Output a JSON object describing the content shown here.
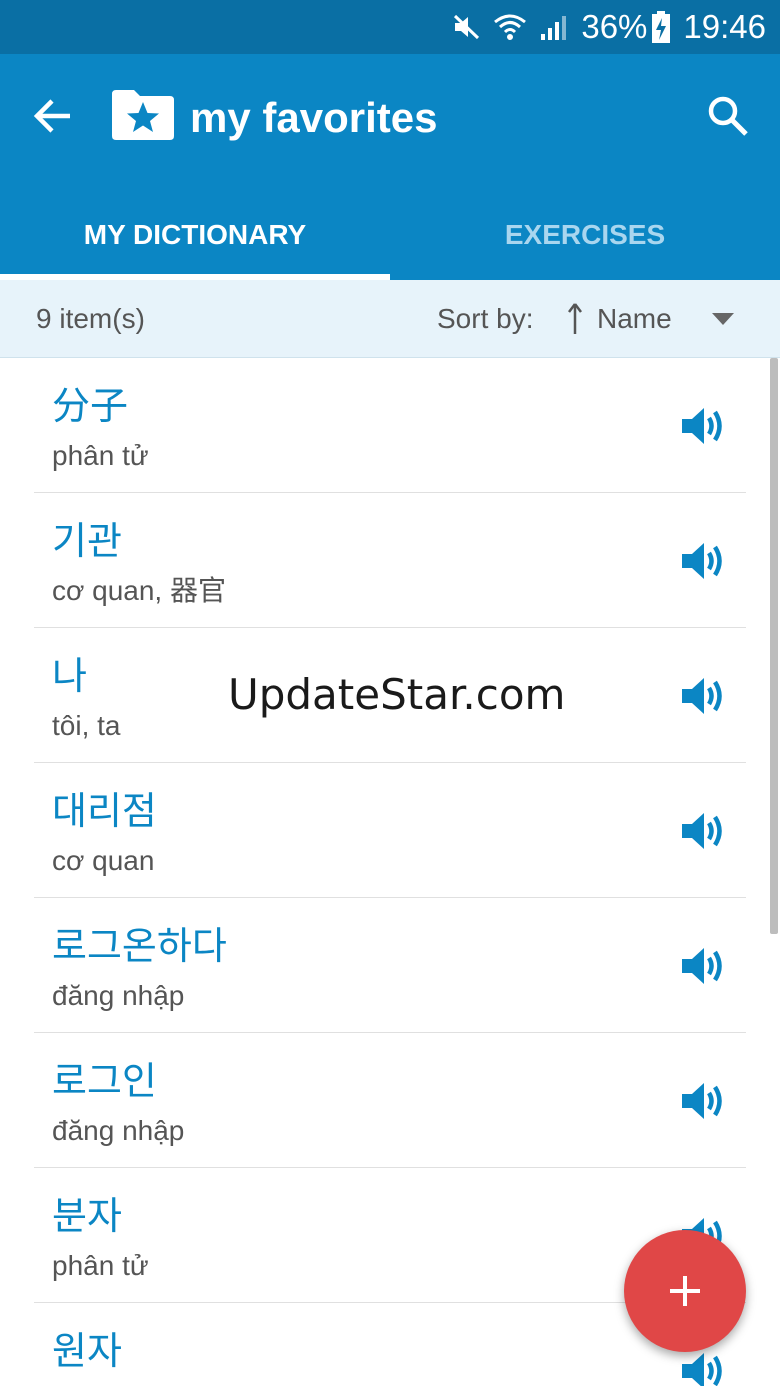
{
  "status_bar": {
    "battery": "36%",
    "time": "19:46",
    "icons": [
      "mute-icon",
      "wifi-icon",
      "signal-icon",
      "battery-charging-icon"
    ]
  },
  "app_bar": {
    "title": "my favorites",
    "title_icon": "star-folder-icon",
    "back_icon": "arrow-back-icon",
    "search_icon": "search-icon"
  },
  "tabs": [
    {
      "label": "MY DICTIONARY",
      "active": true
    },
    {
      "label": "EXERCISES",
      "active": false
    }
  ],
  "toolbar": {
    "item_count": "9 item(s)",
    "sort_label": "Sort by:",
    "sort_value": "Name"
  },
  "items": [
    {
      "word": "分子",
      "meaning": "phân tử"
    },
    {
      "word": "기관",
      "meaning": "cơ quan, 器官"
    },
    {
      "word": "나",
      "meaning": "tôi, ta"
    },
    {
      "word": "대리점",
      "meaning": "cơ quan"
    },
    {
      "word": "로그온하다",
      "meaning": "đăng nhập"
    },
    {
      "word": "로그인",
      "meaning": "đăng nhập"
    },
    {
      "word": "분자",
      "meaning": "phân tử"
    },
    {
      "word": "원자",
      "meaning": ""
    }
  ],
  "watermark": "UpdateStar.com",
  "fab_icon": "add-icon",
  "colors": {
    "primary": "#0b86c4",
    "status_bar": "#0a6fa4",
    "fab": "#e04747"
  }
}
